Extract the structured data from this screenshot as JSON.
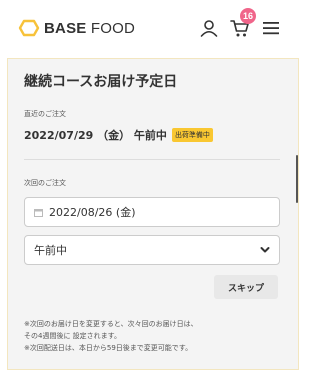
{
  "header": {
    "logo_bold": "BASE",
    "logo_light": "FOOD",
    "cart_count": "16",
    "icons": [
      "user-icon",
      "cart-icon",
      "menu-icon"
    ],
    "colors": {
      "logo_accent": "#f7c23a",
      "badge": "#f0658a"
    }
  },
  "page": {
    "title": "継続コースお届け予定日"
  },
  "recent_order": {
    "label": "直近のご注文",
    "date": "2022/07/29 （金） 午前中",
    "status": "出荷準備中",
    "status_color": "#f9c731"
  },
  "next_order": {
    "label": "次回のご注文",
    "date_value": "2022/08/26 (金)",
    "time_value": "午前中",
    "skip_label": "スキップ"
  },
  "notes": {
    "line1": "※次回のお届け日を変更すると、次々回のお届け日は、",
    "line2": "その4週間後に 設定されます。",
    "line3": "※次回配送日は、本日から59日後まで変更可能です。"
  }
}
